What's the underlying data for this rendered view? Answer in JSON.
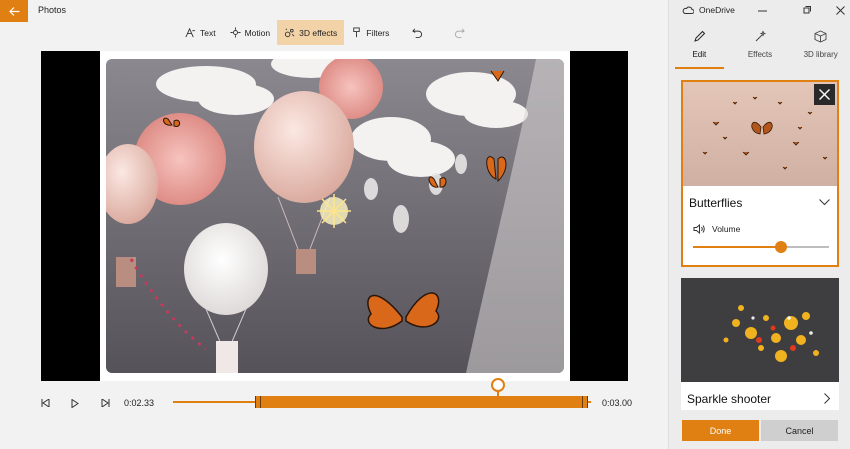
{
  "app": {
    "title": "Photos"
  },
  "toolbar": {
    "tools": [
      {
        "label": "Text",
        "icon": "text-icon"
      },
      {
        "label": "Motion",
        "icon": "motion-icon"
      },
      {
        "label": "3D effects",
        "icon": "3d-effects-icon",
        "active": true
      },
      {
        "label": "Filters",
        "icon": "filters-icon"
      }
    ],
    "undo_icon": "undo-icon",
    "redo_icon": "redo-icon"
  },
  "player": {
    "current_time": "0:02.33",
    "end_time": "0:03.00",
    "playhead_fraction": 0.77
  },
  "panel": {
    "account": "OneDrive",
    "tabs": [
      {
        "label": "Edit",
        "active": true
      },
      {
        "label": "Effects"
      },
      {
        "label": "3D library"
      }
    ],
    "effects": [
      {
        "name": "Butterflies",
        "selected": true,
        "volume_label": "Volume",
        "volume_fraction": 0.65
      },
      {
        "name": "Sparkle shooter"
      }
    ],
    "done_label": "Done",
    "cancel_label": "Cancel"
  },
  "colors": {
    "accent": "#e07f12",
    "accent_light": "#f2d3a8"
  }
}
